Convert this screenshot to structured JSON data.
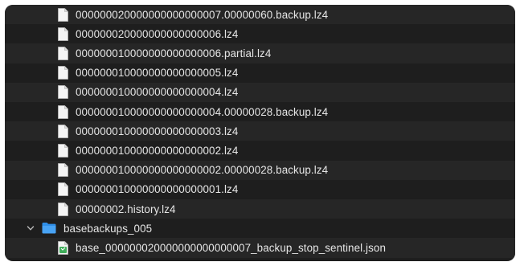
{
  "file_list": {
    "files": [
      {
        "name": "000000020000000000000007.00000060.backup.lz4",
        "icon": "document-icon"
      },
      {
        "name": "000000020000000000000006.lz4",
        "icon": "document-icon"
      },
      {
        "name": "000000010000000000000006.partial.lz4",
        "icon": "document-icon"
      },
      {
        "name": "000000010000000000000005.lz4",
        "icon": "document-icon"
      },
      {
        "name": "000000010000000000000004.lz4",
        "icon": "document-icon"
      },
      {
        "name": "000000010000000000000004.00000028.backup.lz4",
        "icon": "document-icon"
      },
      {
        "name": "000000010000000000000003.lz4",
        "icon": "document-icon"
      },
      {
        "name": "000000010000000000000002.lz4",
        "icon": "document-icon"
      },
      {
        "name": "000000010000000000000002.00000028.backup.lz4",
        "icon": "document-icon"
      },
      {
        "name": "000000010000000000000001.lz4",
        "icon": "document-icon"
      },
      {
        "name": "00000002.history.lz4",
        "icon": "document-icon"
      }
    ],
    "folder": {
      "name": "basebackups_005",
      "icon": "folder-icon",
      "expanded": true,
      "children": [
        {
          "name": "base_000000020000000000000007_backup_stop_sentinel.json",
          "icon": "json-file-icon"
        }
      ]
    }
  },
  "colors": {
    "background": "#1e1e1e",
    "row_alt": "#262626",
    "text": "#e6e6e6",
    "folder_blue": "#2f8fe8",
    "json_green": "#3fae5a"
  }
}
